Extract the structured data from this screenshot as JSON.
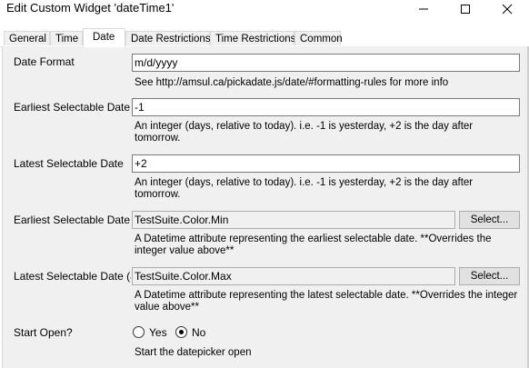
{
  "window": {
    "title": "Edit Custom Widget 'dateTime1'",
    "minimize_icon": "minimize-icon",
    "maximize_icon": "maximize-icon",
    "close_icon": "close-icon"
  },
  "tabs": [
    {
      "label": "General",
      "active": false
    },
    {
      "label": "Time",
      "active": false
    },
    {
      "label": "Date",
      "active": true
    },
    {
      "label": "Date Restrictions",
      "active": false
    },
    {
      "label": "Time Restrictions",
      "active": false
    },
    {
      "label": "Common",
      "active": false
    }
  ],
  "fields": {
    "date_format": {
      "label": "Date Format",
      "value": "m/d/yyyy",
      "hint": "See http://amsul.ca/pickadate.js/date/#formatting-rules for more info"
    },
    "earliest_date": {
      "label": "Earliest Selectable Date",
      "value": "-1",
      "hint_line1": "An integer (days, relative to today). i.e. -1 is yesterday, +2 is the day after",
      "hint_line2": "tomorrow."
    },
    "latest_date": {
      "label": "Latest Selectable Date",
      "value": "+2",
      "hint_line1": "An integer (days, relative to today). i.e. -1 is yesterday, +2 is the day after",
      "hint_line2": "tomorrow."
    },
    "earliest_attr": {
      "label": "Earliest Selectable Date (attribute)",
      "value": "TestSuite.Color.Min",
      "button": "Select...",
      "hint_line1": "A Datetime attribute representing the earliest selectable date. **Overrides the",
      "hint_line2": "integer value above**"
    },
    "latest_attr": {
      "label": "Latest Selectable Date (attribute)",
      "value": "TestSuite.Color.Max",
      "button": "Select...",
      "hint_line1": "A Datetime attribute representing the latest selectable date. **Overrides the integer",
      "hint_line2": "value above**"
    },
    "start_open": {
      "label": "Start Open?",
      "option_yes": "Yes",
      "option_no": "No",
      "selected": "No",
      "hint": "Start the datepicker open"
    }
  }
}
